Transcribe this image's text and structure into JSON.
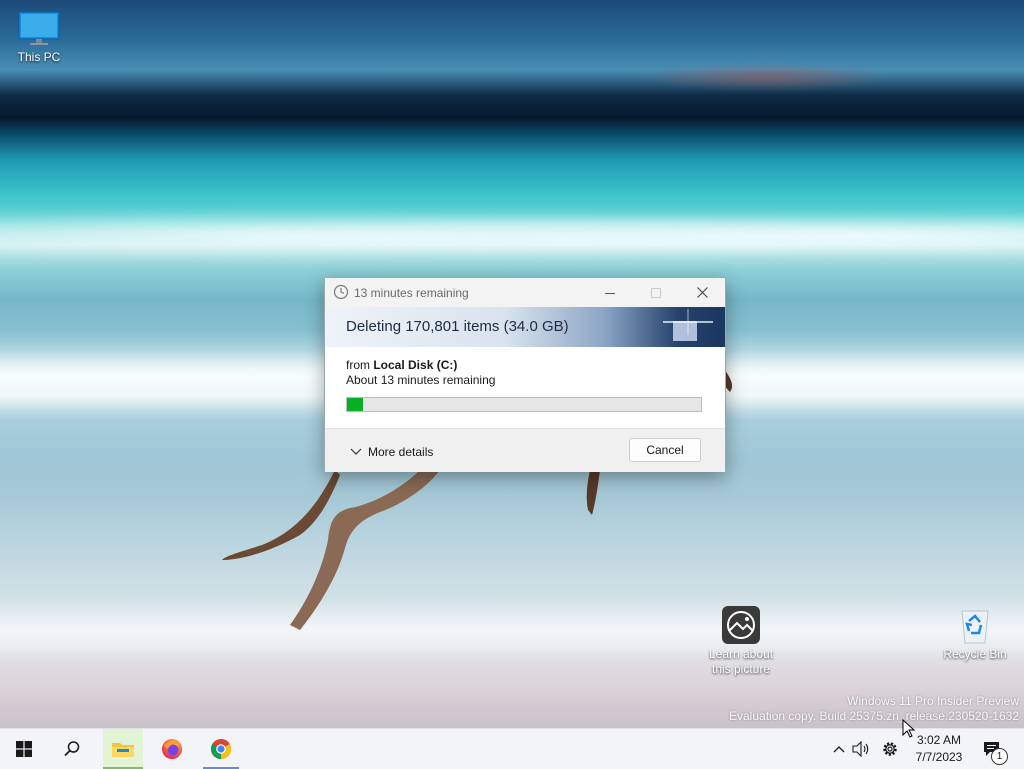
{
  "desktop": {
    "icons": [
      {
        "label": "This PC"
      },
      {
        "label": "Learn about this picture"
      },
      {
        "label": "Recycle Bin"
      }
    ],
    "watermark": {
      "line1": "Windows 11 Pro Insider Preview",
      "line2": "Evaluation copy. Build 25375.zn_release.230520-1632"
    }
  },
  "dialog": {
    "title": "13 minutes remaining",
    "heading": "Deleting 170,801 items (34.0 GB)",
    "from_prefix": "from",
    "from_location": "Local Disk (C:)",
    "time_remaining": "About 13 minutes remaining",
    "progress_fraction": 0.045,
    "more_details_label": "More details",
    "cancel_label": "Cancel",
    "progress_color": "#06b025"
  },
  "taskbar": {
    "items": [
      "start-icon",
      "search-icon",
      "file-explorer-icon",
      "firefox-icon",
      "chrome-icon"
    ],
    "time": "3:02 AM",
    "date": "7/7/2023",
    "notification_count": "1"
  }
}
